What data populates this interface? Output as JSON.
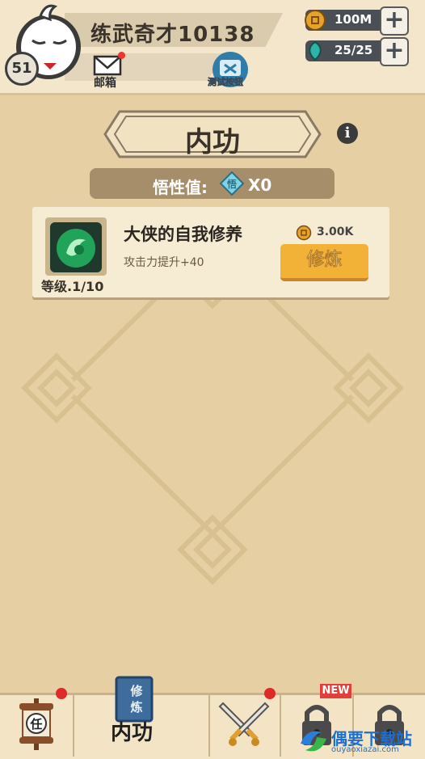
{
  "header": {
    "player_name": "练武奇才10138",
    "level": "51",
    "mail_label": "邮箱",
    "test_button_label": "测试按钮",
    "resources": [
      {
        "icon": "coin-icon",
        "value": "100M"
      },
      {
        "icon": "spirit-gem-icon",
        "value": "25/25"
      }
    ]
  },
  "page": {
    "title": "内功",
    "comprehension_label": "悟性值:",
    "comprehension_gem_char": "悟",
    "comprehension_value": "X0"
  },
  "skill": {
    "name": "大侠的自我修养",
    "description": "攻击力提升+40",
    "level_text": "等级.1/10",
    "cost": "3.00K",
    "train_label": "修炼"
  },
  "nav": {
    "tabs": [
      {
        "icon": "quest-scroll-icon",
        "glyph": "任",
        "has_dot": true
      },
      {
        "icon": "training-book-icon",
        "book_text": "修炼",
        "label": "内功",
        "active": true
      },
      {
        "icon": "crossed-swords-icon",
        "has_dot": true
      },
      {
        "icon": "lock-icon",
        "badge": "NEW"
      },
      {
        "icon": "lock-icon"
      }
    ]
  },
  "watermark": {
    "text": "偶要下载站",
    "sub": "ouyaoxiazai.com"
  },
  "colors": {
    "background": "#e6d0a3",
    "button_orange": "#f2b237",
    "badge_red": "#e02a2a"
  }
}
